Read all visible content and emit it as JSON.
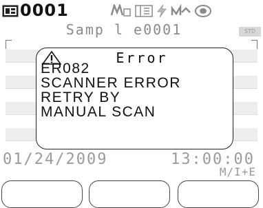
{
  "status": {
    "sample_number": "0001",
    "icons": [
      "memory-card-icon",
      "measure-mode-icon",
      "grid-mode-icon",
      "battery-icon",
      "ac-power-icon",
      "target-mode-icon"
    ]
  },
  "sample": {
    "name": "Samp l e0001",
    "tag": "STD"
  },
  "dialog": {
    "title": "Error",
    "lines": [
      "ER082",
      "SCANNER ERROR",
      "RETRY BY",
      "MANUAL SCAN"
    ]
  },
  "footer": {
    "date": "01/24/2009",
    "time": "13:00:00",
    "mode": "M/I+E"
  },
  "softkeys": [
    {
      "label": ""
    },
    {
      "label": ""
    },
    {
      "label": ""
    }
  ],
  "colors": {
    "text_dark": "#111111",
    "text_dim": "#9a9a9a",
    "border": "#222222",
    "background": "#ffffff"
  }
}
